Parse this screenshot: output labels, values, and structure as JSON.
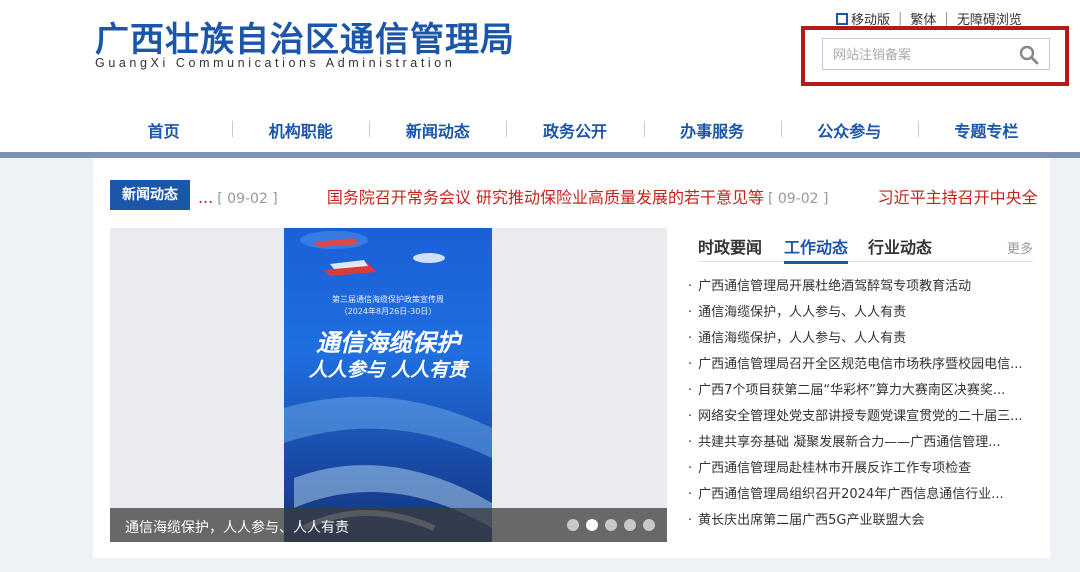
{
  "header": {
    "title_cn": "广西壮族自治区通信管理局",
    "title_en": "GuangXi Communications Administration",
    "links": [
      "移动版",
      "繁体",
      "无障碍浏览"
    ],
    "search_placeholder": "网站注销备案"
  },
  "nav": [
    "首页",
    "机构职能",
    "新闻动态",
    "政务公开",
    "办事服务",
    "公众参与",
    "专题专栏"
  ],
  "ticker": {
    "label": "新闻动态",
    "items": [
      {
        "text": "...",
        "date": "[ 09-02 ]"
      },
      {
        "text": "国务院召开常务会议 研究推动保险业高质量发展的若干意见等",
        "date": "[ 09-02 ]"
      },
      {
        "text": "习近平主持召开中央全",
        "date": ""
      }
    ]
  },
  "slider": {
    "caption": "通信海缆保护，人人参与、人人有责",
    "poster": {
      "subtitle": "第三届通信海缆保护政策宣传周",
      "dates": "（2024年8月26日-30日）",
      "headline1": "通信海缆保护",
      "headline2": "人人参与 人人有责"
    },
    "dots": 5,
    "active_dot": 2
  },
  "tabs": {
    "items": [
      "时政要闻",
      "工作动态",
      "行业动态"
    ],
    "active": 1,
    "more": "更多"
  },
  "news": [
    "广西通信管理局开展杜绝酒驾醉驾专项教育活动",
    "通信海缆保护，人人参与、人人有责",
    "通信海缆保护，人人参与、人人有责",
    "广西通信管理局召开全区规范电信市场秩序暨校园电信...",
    "广西7个项目获第二届“华彩杯”算力大赛南区决赛奖...",
    "网络安全管理处党支部讲授专题党课宣贯党的二十届三...",
    "共建共享夯基础 凝聚发展新合力——广西通信管理...",
    "广西通信管理局赴桂林市开展反诈工作专项检查",
    "广西通信管理局组织召开2024年广西信息通信行业...",
    "黄长庆出席第二届广西5G产业联盟大会"
  ],
  "colors": {
    "brand_blue": "#1b56a9",
    "ticker_red": "#c6231b",
    "highlight_red": "#b31b1b"
  }
}
